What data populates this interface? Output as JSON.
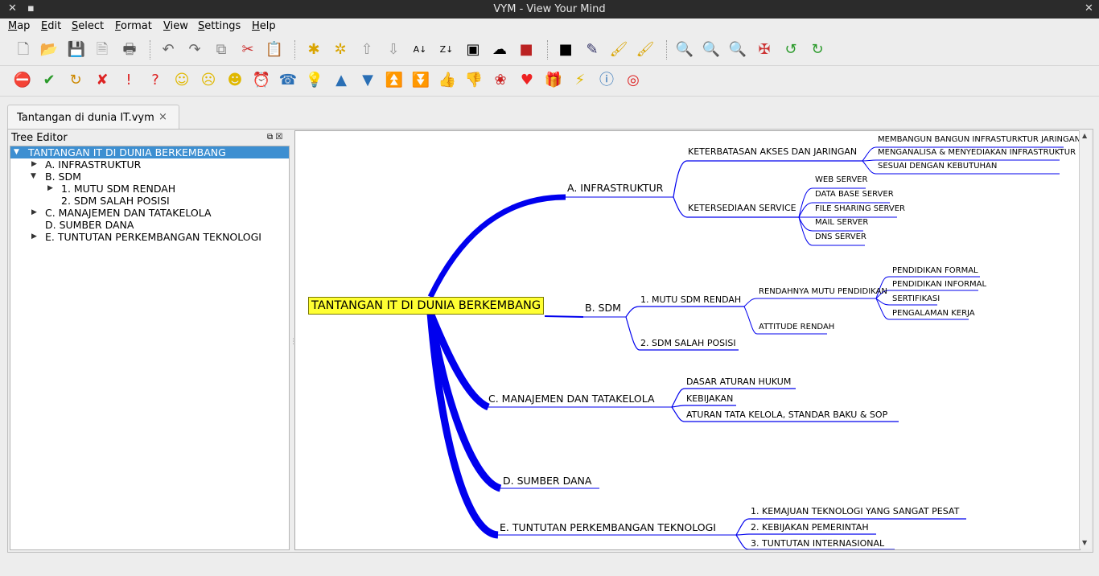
{
  "window": {
    "title": "VYM - View Your Mind"
  },
  "menu": [
    "Map",
    "Edit",
    "Select",
    "Format",
    "View",
    "Settings",
    "Help"
  ],
  "toolbar1_icons": [
    "new-map-icon",
    "open-icon",
    "save-icon",
    "export-icon",
    "print-icon",
    "undo-icon",
    "redo-icon",
    "copy-icon",
    "cut-icon",
    "paste-icon",
    "add-branch-icon",
    "add-branch-above-icon",
    "move-up-icon",
    "move-down-icon",
    "sort-az-icon",
    "sort-za-icon",
    "image-icon",
    "cloud-icon",
    "color-icon",
    "frame-icon",
    "pick-color-icon",
    "format-painter-icon",
    "format-painter-all-icon",
    "zoom-in-icon",
    "zoom-out-icon",
    "zoom-reset-icon",
    "center-icon",
    "rotate-left-icon",
    "rotate-right-icon"
  ],
  "toolbar2_icons": [
    "stop-flag-icon",
    "ok-flag-icon",
    "refresh-flag-icon",
    "cross-flag-icon",
    "exclamation-flag-icon",
    "question-flag-icon",
    "smiley-good-icon",
    "smiley-sad-icon",
    "smiley-omg-icon",
    "clock-icon",
    "phone-icon",
    "lamp-icon",
    "arrow-up-icon",
    "arrow-down-icon",
    "arrow-2up-icon",
    "arrow-2down-icon",
    "thumb-up-icon",
    "thumb-down-icon",
    "rose-icon",
    "heart-icon",
    "present-icon",
    "flash-icon",
    "info-icon",
    "lifebelt-icon"
  ],
  "tab": {
    "label": "Tantangan di dunia IT.vym",
    "close": "×"
  },
  "tree": {
    "header": "Tree Editor",
    "items": [
      "TANTANGAN IT DI DUNIA BERKEMBANG",
      "A. INFRASTRUKTUR",
      "B. SDM",
      "1. MUTU SDM RENDAH",
      "2. SDM SALAH POSISI",
      "C. MANAJEMEN DAN TATAKELOLA",
      "D. SUMBER DANA",
      "E. TUNTUTAN PERKEMBANGAN TEKNOLOGI"
    ]
  },
  "map": {
    "root": "TANTANGAN IT DI DUNIA BERKEMBANG",
    "a": {
      "label": "A. INFRASTRUKTUR",
      "c1": "KETERBATASAN AKSES DAN JARINGAN",
      "c1_items": [
        "MEMBANGUN BANGUN INFRASTURKTUR JARINGAN",
        "MENGANALISA & MENYEDIAKAN INFRASTRUKTUR",
        "SESUAI DENGAN KEBUTUHAN"
      ],
      "c2": "KETERSEDIAAN SERVICE",
      "c2_items": [
        "WEB SERVER",
        "DATA BASE SERVER",
        "FILE SHARING SERVER",
        "MAIL SERVER",
        "DNS SERVER"
      ]
    },
    "b": {
      "label": "B. SDM",
      "c1": "1. MUTU SDM RENDAH",
      "c1a": "RENDAHNYA MUTU PENDIDIKAN",
      "c1a_items": [
        "PENDIDIKAN FORMAL",
        "PENDIDIKAN INFORMAL",
        "SERTIFIKASI",
        "PENGALAMAN KERJA"
      ],
      "c1b": "ATTITUDE RENDAH",
      "c2": "2. SDM SALAH POSISI"
    },
    "c": {
      "label": "C. MANAJEMEN DAN TATAKELOLA",
      "items": [
        "DASAR ATURAN HUKUM",
        "KEBIJAKAN",
        "ATURAN TATA KELOLA, STANDAR BAKU & SOP"
      ]
    },
    "d": {
      "label": "D. SUMBER DANA"
    },
    "e": {
      "label": "E. TUNTUTAN PERKEMBANGAN TEKNOLOGI",
      "items": [
        "1. KEMAJUAN TEKNOLOGI YANG SANGAT PESAT",
        "2. KEBIJAKAN PEMERINTAH",
        "3. TUNTUTAN INTERNASIONAL"
      ]
    },
    "link_color": "#0000ee",
    "root_color": "#ffff33"
  }
}
